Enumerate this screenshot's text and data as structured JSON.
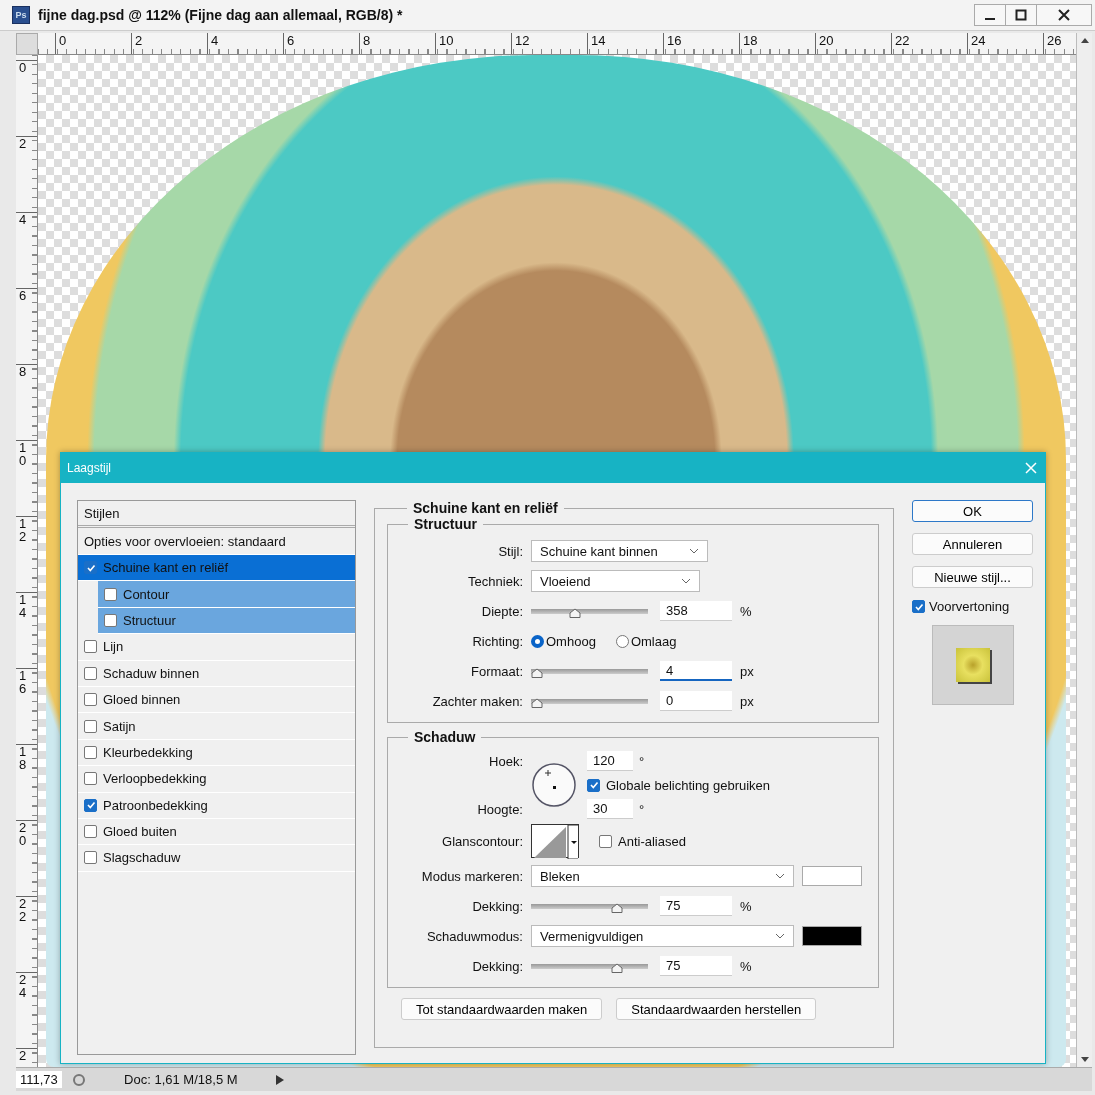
{
  "window": {
    "app_icon": "Ps",
    "title": "fijne dag.psd @ 112% (Fijne dag aan allemaal, RGB/8) *"
  },
  "rulers": {
    "horizontal": [
      "0",
      "2",
      "4",
      "6",
      "8",
      "10",
      "12",
      "14",
      "16",
      "18",
      "20",
      "22",
      "24",
      "26"
    ],
    "vertical": [
      "0",
      "2",
      "4",
      "6",
      "8",
      "10",
      "12",
      "14",
      "16",
      "18",
      "20",
      "22",
      "24",
      "2"
    ]
  },
  "status_bar": {
    "zoom": "111,73",
    "doc_info": "Doc: 1,61 M/18,5 M"
  },
  "dialog": {
    "title": "Laagstijl",
    "styles": {
      "header": "Stijlen",
      "blending_options": "Opties voor overvloeien: standaard",
      "items": [
        {
          "label": "Schuine kant en reliëf",
          "checked": true,
          "selected": true,
          "children": [
            {
              "label": "Contour",
              "checked": false,
              "selected": false
            },
            {
              "label": "Structuur",
              "checked": false,
              "selected": false
            }
          ]
        },
        {
          "label": "Lijn",
          "checked": false,
          "selected": false
        },
        {
          "label": "Schaduw binnen",
          "checked": false,
          "selected": false
        },
        {
          "label": "Gloed binnen",
          "checked": false,
          "selected": false
        },
        {
          "label": "Satijn",
          "checked": false,
          "selected": false
        },
        {
          "label": "Kleurbedekking",
          "checked": false,
          "selected": false
        },
        {
          "label": "Verloopbedekking",
          "checked": false,
          "selected": false
        },
        {
          "label": "Patroonbedekking",
          "checked": true,
          "selected": false
        },
        {
          "label": "Gloed buiten",
          "checked": false,
          "selected": false
        },
        {
          "label": "Slagschaduw",
          "checked": false,
          "selected": false
        }
      ]
    },
    "section_title": "Schuine kant en reliëf",
    "structure": {
      "title": "Structuur",
      "style": {
        "label": "Stijl:",
        "value": "Schuine kant binnen"
      },
      "technique": {
        "label": "Techniek:",
        "value": "Vloeiend"
      },
      "depth": {
        "label": "Diepte:",
        "level": 0.36,
        "value": "358",
        "unit": "%",
        "focused": false
      },
      "direction": {
        "label": "Richting:",
        "options": [
          {
            "label": "Omhoog",
            "selected": true
          },
          {
            "label": "Omlaag",
            "selected": false
          }
        ]
      },
      "size": {
        "label": "Formaat:",
        "level": 0,
        "value": "4",
        "unit": "px",
        "focused": true
      },
      "soften": {
        "label": "Zachter maken:",
        "level": 0,
        "value": "0",
        "unit": "px",
        "focused": false
      }
    },
    "shading": {
      "title": "Schaduw",
      "angle": {
        "label": "Hoek:",
        "value": "120",
        "unit": "°"
      },
      "global_light": {
        "label": "Globale belichting gebruiken",
        "checked": true
      },
      "altitude": {
        "label": "Hoogte:",
        "value": "30",
        "unit": "°"
      },
      "gloss_contour": {
        "label": "Glanscontour:"
      },
      "anti_aliased": {
        "label": "Anti-aliased",
        "checked": false
      },
      "highlight_mode": {
        "label": "Modus markeren:",
        "value": "Bleken",
        "color": "#ffffff"
      },
      "highlight_opacity": {
        "label": "Dekking:",
        "level": 0.76,
        "value": "75",
        "unit": "%",
        "focused": false
      },
      "shadow_mode": {
        "label": "Schaduwmodus:",
        "value": "Vermenigvuldigen",
        "color": "#000000"
      },
      "shadow_opacity": {
        "label": "Dekking:",
        "level": 0.76,
        "value": "75",
        "unit": "%",
        "focused": false
      }
    },
    "bottom_buttons": [
      "Tot standaardwaarden maken",
      "Standaardwaarden herstellen"
    ],
    "buttons": [
      {
        "label": "OK",
        "primary": true
      },
      {
        "label": "Annuleren",
        "primary": false
      },
      {
        "label": "Nieuwe stijl...",
        "primary": false
      }
    ],
    "preview": {
      "label": "Voorvertoning",
      "checked": true
    }
  }
}
